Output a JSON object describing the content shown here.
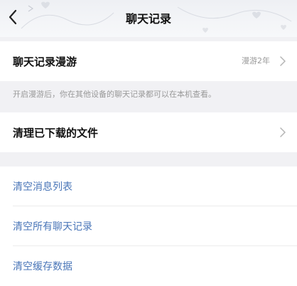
{
  "header": {
    "title": "聊天记录"
  },
  "roaming": {
    "label": "聊天记录漫游",
    "value": "漫游2年",
    "note": "开启漫游后，你在其他设备的聊天记录都可以在本机查看。"
  },
  "downloads": {
    "label": "清理已下载的文件"
  },
  "actions": [
    {
      "label": "清空消息列表"
    },
    {
      "label": "清空所有聊天记录"
    },
    {
      "label": "清空缓存数据"
    }
  ],
  "colors": {
    "accent_link": "#4a76b8",
    "background": "#f1f1f4"
  }
}
